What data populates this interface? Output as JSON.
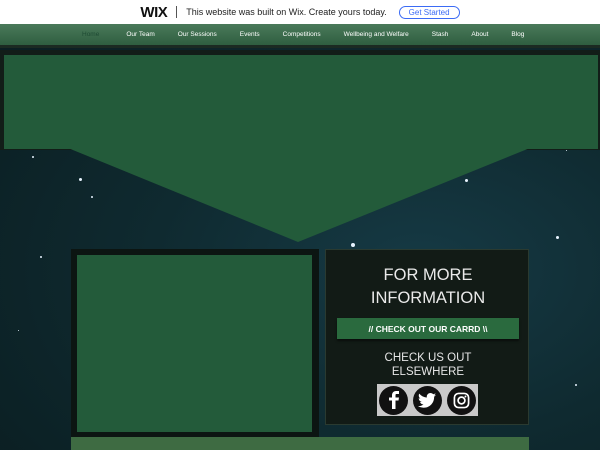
{
  "wix_banner": {
    "logo": "WIX",
    "message": "This website was built on Wix. Create yours today.",
    "button": "Get Started"
  },
  "nav": {
    "items": [
      {
        "label": "Home",
        "active": true
      },
      {
        "label": "Our Team"
      },
      {
        "label": "Our Sessions"
      },
      {
        "label": "Events"
      },
      {
        "label": "Competitions"
      },
      {
        "label": "Wellbeing and Welfare"
      },
      {
        "label": "Stash"
      },
      {
        "label": "About"
      },
      {
        "label": "Blog"
      }
    ]
  },
  "info": {
    "title_line1": "FOR MORE",
    "title_line2": "INFORMATION",
    "card_button": "// CHECK OUT OUR CARRD \\\\",
    "elsewhere_line1": "CHECK US OUT",
    "elsewhere_line2": "ELSEWHERE"
  },
  "social": {
    "icons": [
      "facebook-icon",
      "twitter-icon",
      "instagram-icon"
    ]
  },
  "colors": {
    "hero_green": "#235b3a",
    "nav_green": "#3d6e4f",
    "button_green": "#2a6a3e"
  }
}
